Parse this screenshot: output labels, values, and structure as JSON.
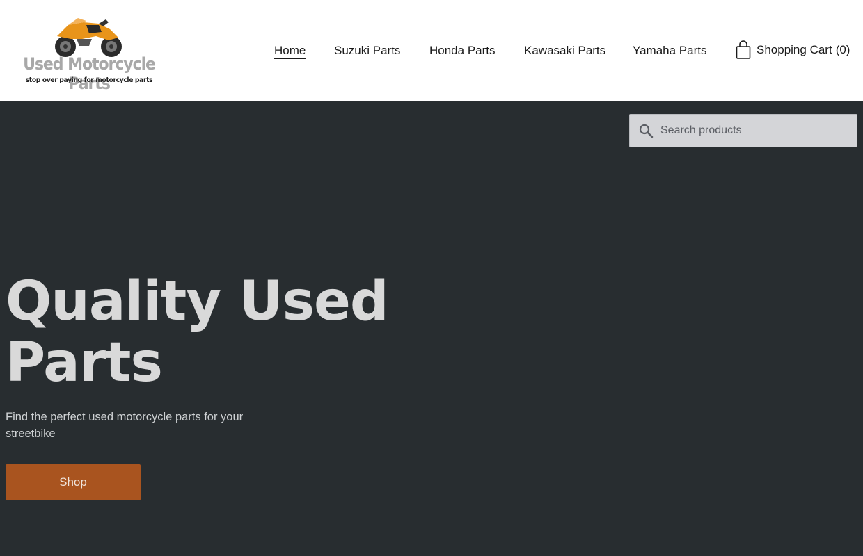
{
  "logo": {
    "brand": "Used Motorcycle Parts",
    "tagline": "stop over paying for motorcycle parts",
    "icon": "motorcycle-icon",
    "accent": "#e8941a"
  },
  "nav": {
    "items": [
      {
        "label": "Home",
        "active": true
      },
      {
        "label": "Suzuki Parts",
        "active": false
      },
      {
        "label": "Honda Parts",
        "active": false
      },
      {
        "label": "Kawasaki Parts",
        "active": false
      },
      {
        "label": "Yamaha Parts",
        "active": false
      }
    ]
  },
  "cart": {
    "label": "Shopping Cart",
    "count": "(0)",
    "icon": "shopping-bag-icon"
  },
  "search": {
    "placeholder": "Search products",
    "icon": "search-icon"
  },
  "hero": {
    "title": "Quality Used Parts",
    "subtitle": "Find the perfect used motorcycle parts for your streetbike",
    "cta_label": "Shop",
    "background": "#282d30",
    "cta_color": "#a9541f"
  }
}
